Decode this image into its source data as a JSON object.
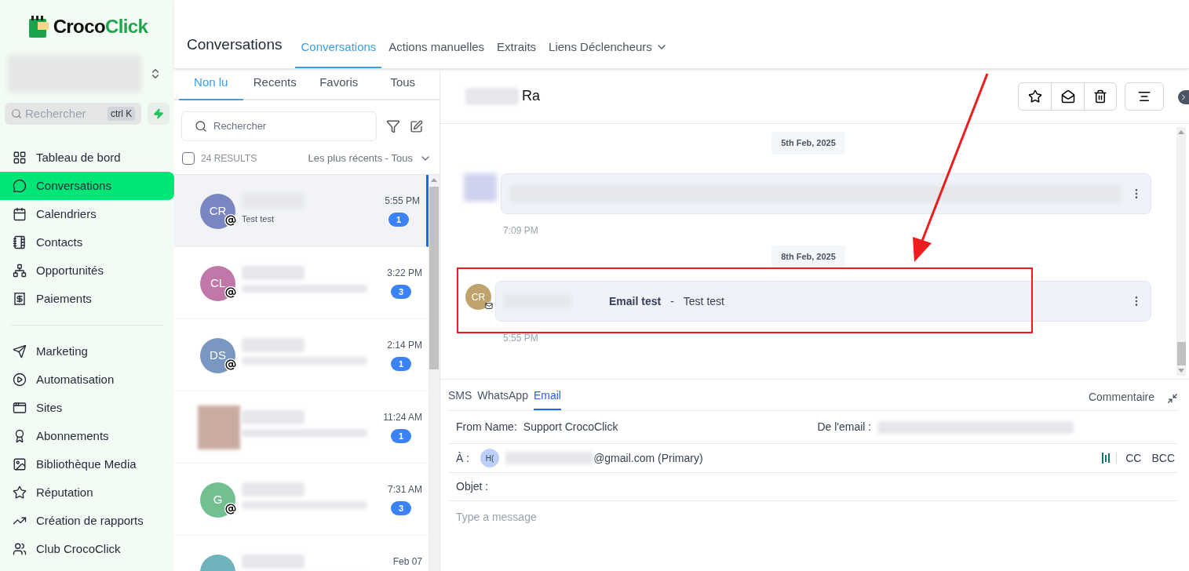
{
  "logo": {
    "part_1": "Croco",
    "part_2": "Click"
  },
  "sidebar": {
    "search": {
      "placeholder": "Rechercher",
      "shortcut": "ctrl K"
    },
    "items": [
      {
        "label": "Tableau de bord",
        "selected": false
      },
      {
        "label": "Conversations",
        "selected": true
      },
      {
        "label": "Calendriers",
        "selected": false
      },
      {
        "label": "Contacts",
        "selected": false
      },
      {
        "label": "Opportunités",
        "selected": false
      },
      {
        "label": "Paiements",
        "selected": false
      }
    ],
    "items_2": [
      {
        "label": "Marketing",
        "selected": false
      },
      {
        "label": "Automatisation",
        "selected": false
      },
      {
        "label": "Sites",
        "selected": false
      },
      {
        "label": "Abonnements",
        "selected": false
      },
      {
        "label": "Bibliothèque Media",
        "selected": false
      },
      {
        "label": "Réputation",
        "selected": false
      },
      {
        "label": "Création de rapports",
        "selected": false
      },
      {
        "label": "Club CrocoClick",
        "selected": false
      }
    ]
  },
  "header": {
    "title": "Conversations",
    "tabs": [
      {
        "label": "Conversations",
        "selected": true
      },
      {
        "label": "Actions manuelles",
        "selected": false
      },
      {
        "label": "Extraits",
        "selected": false
      },
      {
        "label": "Liens Déclencheurs",
        "selected": false,
        "dropdown": true
      }
    ]
  },
  "list": {
    "tabs": [
      {
        "label": "Non lu",
        "selected": true
      },
      {
        "label": "Recents",
        "selected": false
      },
      {
        "label": "Favoris",
        "selected": false
      },
      {
        "label": "Tous",
        "selected": false
      }
    ],
    "search": {
      "placeholder": "Rechercher"
    },
    "select_all": {
      "checked": false
    },
    "results": "24 RESULTS",
    "sort": "Les plus récents - Tous",
    "conversations": [
      {
        "kind": "initials",
        "initials": "CR",
        "color": "#7a86c2",
        "preview": "Test test",
        "time": "5:55 PM",
        "count": "1",
        "selected": true
      },
      {
        "kind": "initials",
        "initials": "CL",
        "color": "#c078a8",
        "time": "3:22 PM",
        "count": "3",
        "selected": false
      },
      {
        "kind": "initials",
        "initials": "DS",
        "color": "#7a97c2",
        "time": "2:14 PM",
        "count": "1",
        "selected": false
      },
      {
        "kind": "photo",
        "time": "11:24 AM",
        "count": "1",
        "selected": false
      },
      {
        "kind": "initials",
        "initials": "G",
        "color": "#72bf8f",
        "time": "7:31 AM",
        "count": "3",
        "selected": false
      },
      {
        "kind": "initials",
        "color": "#6fb3bd",
        "time": "Feb 07",
        "selected": false
      }
    ]
  },
  "chat": {
    "contact_name": "Ra",
    "messages": [
      {
        "date": "5th Feb, 2025",
        "kind": "blurred",
        "time": "7:09 PM"
      },
      {
        "date": "8th Feb, 2025",
        "kind": "email",
        "initials": "CR",
        "subject": "Email test",
        "separator": "-",
        "body": "Test test",
        "time": "5:55 PM"
      }
    ]
  },
  "composer": {
    "tabs": [
      {
        "label": "SMS",
        "selected": false
      },
      {
        "label": "WhatsApp",
        "selected": false
      },
      {
        "label": "Email",
        "selected": true
      }
    ],
    "comment": "Commentaire",
    "from_label": "From Name:",
    "from_value": "Support CrocoClick",
    "email_label": "De l'email :",
    "to_label": "À :",
    "to_initials": "H(",
    "to_value": "@gmail.com (Primary)",
    "cc": "CC",
    "bcc": "BCC",
    "subject_label": "Objet :",
    "message": {
      "placeholder": "Type a message"
    }
  }
}
